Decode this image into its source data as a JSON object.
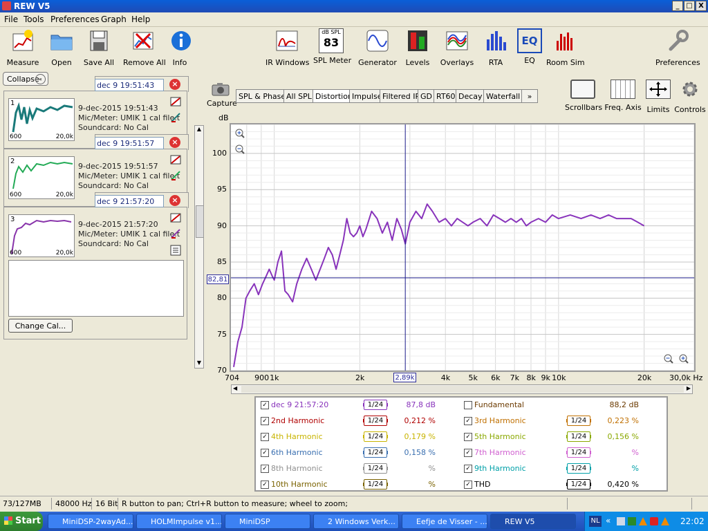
{
  "window": {
    "title": "REW V5",
    "min": "_",
    "max": "□",
    "close": "X"
  },
  "menu": [
    "File",
    "Tools",
    "Preferences",
    "Graph",
    "Help"
  ],
  "toolbar": [
    {
      "label": "Measure",
      "icon": "measure-icon"
    },
    {
      "label": "Open",
      "icon": "folder-icon"
    },
    {
      "label": "Save All",
      "icon": "save-icon"
    },
    {
      "label": "Remove All",
      "icon": "remove-icon"
    },
    {
      "label": "Info",
      "icon": "info-icon"
    },
    {
      "label": "IR Windows",
      "icon": "ir-windows-icon"
    },
    {
      "label": "SPL Meter",
      "icon": "spl-meter-icon",
      "badge_top": "dB SPL",
      "badge_value": "83"
    },
    {
      "label": "Generator",
      "icon": "generator-icon"
    },
    {
      "label": "Levels",
      "icon": "levels-icon"
    },
    {
      "label": "Overlays",
      "icon": "overlays-icon"
    },
    {
      "label": "RTA",
      "icon": "rta-icon"
    },
    {
      "label": "EQ",
      "icon": "eq-icon"
    },
    {
      "label": "Room Sim",
      "icon": "room-sim-icon"
    },
    {
      "label": "Preferences",
      "icon": "wrench-icon"
    }
  ],
  "left": {
    "collapse": "Collapse",
    "measurements": [
      {
        "num": "1",
        "name": "dec 9 19:51:43",
        "date": "9-dec-2015 19:51:43",
        "mic": "Mic/Meter: UMIK 1 cal file.t",
        "sound": "Soundcard: No Cal",
        "low": "600",
        "high": "20,0k",
        "color": "#1a7a7a"
      },
      {
        "num": "2",
        "name": "dec 9 19:51:57",
        "date": "9-dec-2015 19:51:57",
        "mic": "Mic/Meter: UMIK 1 cal file.t",
        "sound": "Soundcard: No Cal",
        "low": "600",
        "high": "20,0k",
        "color": "#22aa55"
      },
      {
        "num": "3",
        "name": "dec 9 21:57:20",
        "date": "9-dec-2015 21:57:20",
        "mic": "Mic/Meter: UMIK 1 cal file.t",
        "sound": "Soundcard: No Cal",
        "low": "600",
        "high": "20,0k",
        "color": "#8833aa"
      }
    ],
    "change_cal": "Change Cal..."
  },
  "graph": {
    "capture": "Capture",
    "tabs": [
      "SPL & Phase",
      "All SPL",
      "Distortion",
      "Impulse",
      "Filtered IR",
      "GD",
      "RT60",
      "Decay",
      "Waterfall"
    ],
    "active_tab": "Distortion",
    "more": "»",
    "right_buttons": [
      "Scrollbars",
      "Freq. Axis",
      "Limits",
      "Controls"
    ],
    "cursor_y": "82,81",
    "cursor_x": "2,89k"
  },
  "chart_data": {
    "type": "line",
    "ylabel": "dB",
    "xlabel": "Hz",
    "xscale": "log",
    "xlim": [
      704,
      30000
    ],
    "ylim": [
      70,
      104
    ],
    "y_ticks": [
      "70",
      "75",
      "80",
      "85",
      "90",
      "95",
      "100"
    ],
    "x_ticks": [
      {
        "v": 704,
        "l": "704"
      },
      {
        "v": 900,
        "l": "900"
      },
      {
        "v": 1000,
        "l": "1k"
      },
      {
        "v": 2000,
        "l": "2k"
      },
      {
        "v": 4000,
        "l": "4k"
      },
      {
        "v": 5000,
        "l": "5k"
      },
      {
        "v": 6000,
        "l": "6k"
      },
      {
        "v": 7000,
        "l": "7k"
      },
      {
        "v": 8000,
        "l": "8k"
      },
      {
        "v": 9000,
        "l": "9k"
      },
      {
        "v": 10000,
        "l": "10k"
      },
      {
        "v": 20000,
        "l": "20k"
      },
      {
        "v": 30000,
        "l": "30,0k Hz"
      }
    ],
    "cursor": {
      "x": 2890,
      "y": 82.81
    },
    "series": [
      {
        "name": "dec 9 21:57:20",
        "color": "#8833bb",
        "x": [
          720,
          745,
          770,
          795,
          820,
          850,
          880,
          910,
          935,
          960,
          985,
          1000,
          1030,
          1060,
          1090,
          1120,
          1160,
          1200,
          1250,
          1300,
          1350,
          1400,
          1450,
          1500,
          1550,
          1600,
          1650,
          1700,
          1750,
          1800,
          1850,
          1900,
          1950,
          2000,
          2050,
          2100,
          2200,
          2300,
          2400,
          2500,
          2600,
          2700,
          2800,
          2890,
          3000,
          3150,
          3300,
          3450,
          3600,
          3800,
          4000,
          4200,
          4400,
          4600,
          4800,
          5000,
          5300,
          5600,
          5900,
          6200,
          6500,
          6800,
          7100,
          7400,
          7700,
          8000,
          8500,
          9000,
          9500,
          10000,
          11000,
          12000,
          13000,
          14000,
          15000,
          16000,
          17000,
          18000,
          19000,
          20000
        ],
        "y": [
          70.5,
          74,
          76,
          80,
          81,
          82,
          80.5,
          82,
          83,
          84,
          83,
          82.5,
          85,
          86.5,
          81,
          80.5,
          79.5,
          82,
          84,
          85.5,
          84,
          82.5,
          84,
          85.5,
          87,
          86,
          84,
          86,
          88,
          91,
          89,
          88.5,
          89,
          90,
          88.5,
          89.5,
          92,
          91,
          89,
          90.5,
          88,
          91,
          89.5,
          87.5,
          90.5,
          92,
          91,
          93,
          92,
          90.5,
          91,
          90,
          91,
          90.5,
          90,
          90.5,
          91,
          90,
          91.5,
          91,
          90.5,
          91,
          90.5,
          91,
          90,
          90.5,
          91,
          90.5,
          91.5,
          91,
          91.5,
          91,
          91.5,
          91,
          91.5,
          91,
          91,
          91,
          90.5,
          90
        ]
      }
    ]
  },
  "legend": [
    {
      "checked": true,
      "name": "dec 9 21:57:20",
      "smooth": "1/24",
      "value": "87,8 dB",
      "color": "#8833bb"
    },
    {
      "checked": false,
      "name": "Fundamental",
      "smooth": "",
      "value": "88,2 dB",
      "color": "#6b3a00"
    },
    {
      "checked": true,
      "name": "2nd Harmonic",
      "smooth": "1/24",
      "value": "0,212 %",
      "color": "#b00000"
    },
    {
      "checked": true,
      "name": "3rd Harmonic",
      "smooth": "1/24",
      "value": "0,223 %",
      "color": "#c07000"
    },
    {
      "checked": true,
      "name": "4th Harmonic",
      "smooth": "1/24",
      "value": "0,179 %",
      "color": "#c8b400"
    },
    {
      "checked": true,
      "name": "5th Harmonic",
      "smooth": "1/24",
      "value": "0,156 %",
      "color": "#8aa800"
    },
    {
      "checked": true,
      "name": "6th Harmonic",
      "smooth": "1/24",
      "value": "0,158 %",
      "color": "#3a6fb0"
    },
    {
      "checked": true,
      "name": "7th Harmonic",
      "smooth": "1/24",
      "value": "%",
      "color": "#d060d0"
    },
    {
      "checked": true,
      "name": "8th Harmonic",
      "smooth": "1/24",
      "value": "%",
      "color": "#909090"
    },
    {
      "checked": true,
      "name": "9th Harmonic",
      "smooth": "1/24",
      "value": "%",
      "color": "#00a0a8"
    },
    {
      "checked": true,
      "name": "10th Harmonic",
      "smooth": "1/24",
      "value": "%",
      "color": "#7a6200"
    },
    {
      "checked": true,
      "name": "THD",
      "smooth": "1/24",
      "value": "0,420 %",
      "color": "#000000"
    }
  ],
  "status": {
    "mem": "73/127MB",
    "rate": "48000 Hz",
    "bits": "16 Bit",
    "hint": "R button to pan; Ctrl+R button to measure; wheel to zoom;"
  },
  "taskbar": {
    "start": "Start",
    "items": [
      "MiniDSP-2wayAd...",
      "HOLMImpulse  v1...",
      "MiniDSP",
      "2 Windows Verk...",
      "Eefje de Visser - ...",
      "REW V5"
    ],
    "lang": "NL",
    "clock": "22:02"
  }
}
